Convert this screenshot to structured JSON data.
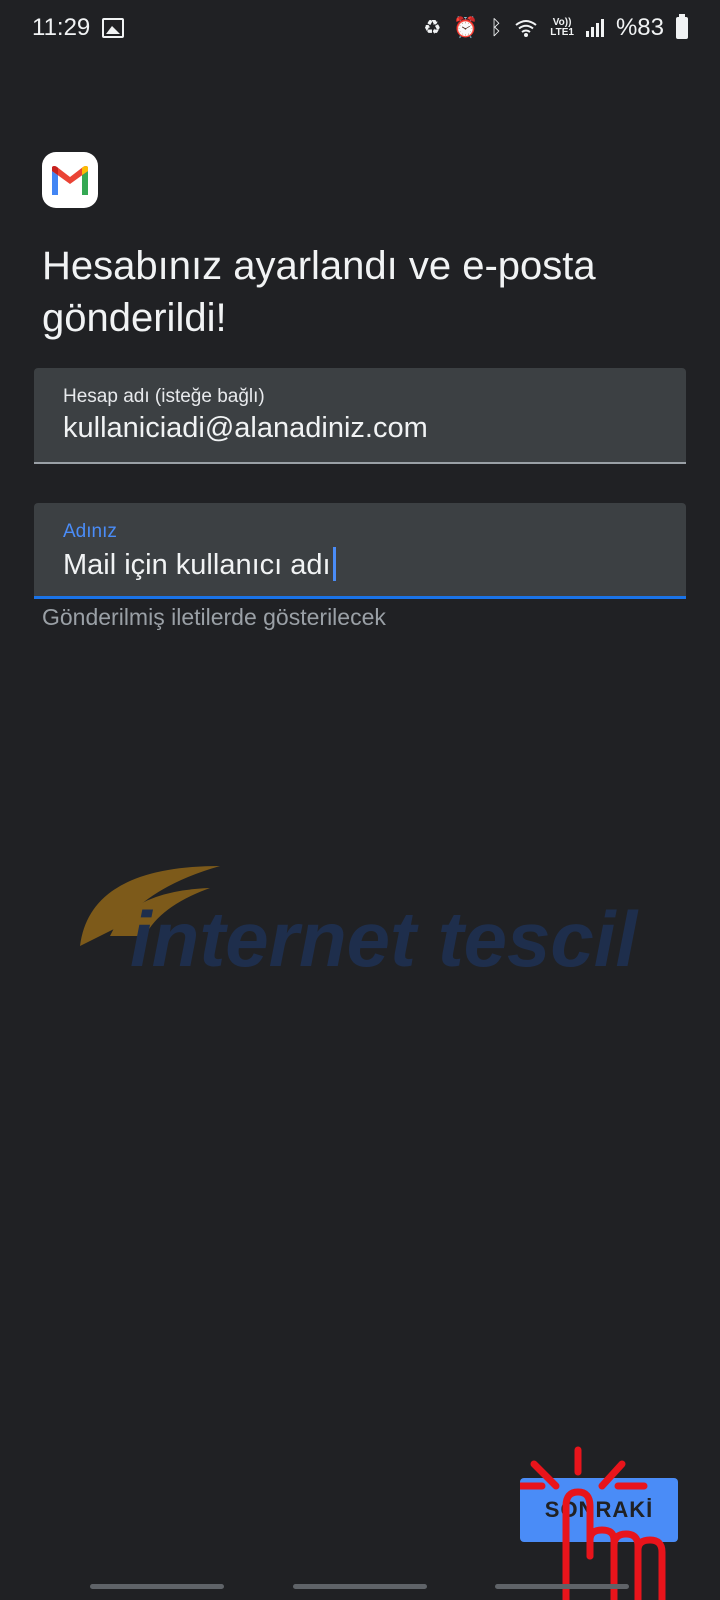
{
  "status_bar": {
    "time": "11:29",
    "battery": "%83",
    "lte": "LTE1",
    "volte": "Vo))",
    "icons": [
      "gallery-icon",
      "battery-saver-icon",
      "alarm-icon",
      "bluetooth-icon",
      "wifi-icon",
      "volte-icon",
      "signal-icon",
      "battery-icon"
    ]
  },
  "header": {
    "logo": "gmail-logo",
    "title": "Hesabınız ayarlandı ve e-posta gönderildi!"
  },
  "form": {
    "account_name": {
      "label": "Hesap adı (isteğe bağlı)",
      "value": "kullaniciadi@alanadiniz.com"
    },
    "your_name": {
      "label": "Adınız",
      "value": "Mail için kullanıcı adı",
      "helper": "Gönderilmiş iletilerde gösterilecek"
    }
  },
  "watermark": {
    "text": "internet tescil",
    "colors": {
      "swoosh": "#c98a12",
      "text": "#1d3a6e"
    }
  },
  "actions": {
    "next_label": "SONRAKİ"
  },
  "colors": {
    "background": "#202124",
    "field": "#3c4043",
    "accent": "#4a8cf7",
    "tap_indicator": "#e8141b"
  }
}
